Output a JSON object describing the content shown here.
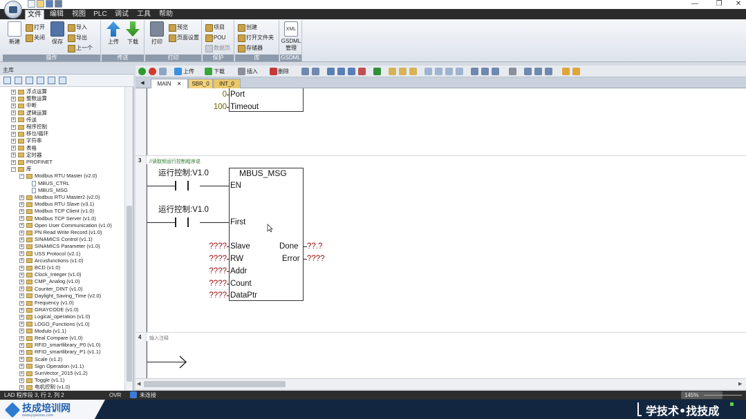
{
  "menu": {
    "tabs": [
      {
        "label": "文件",
        "active": true
      },
      {
        "label": "编辑"
      },
      {
        "label": "视图"
      },
      {
        "label": "PLC"
      },
      {
        "label": "调试"
      },
      {
        "label": "工具"
      },
      {
        "label": "帮助"
      }
    ]
  },
  "ribbon": {
    "groups": {
      "operation": "操作",
      "transfer": "传送",
      "print": "打印",
      "protect": "保护",
      "library": "库",
      "gsdml": "GSDML"
    },
    "new": "新建",
    "open": "打开",
    "close": "关闭",
    "save": "保存",
    "import": "导入",
    "export": "导出",
    "previous": "上一个",
    "upload": "上传",
    "download": "下载",
    "print_btn": "打印",
    "preview": "预览",
    "page_setup": "页面设置",
    "project": "项目",
    "pou": "POU",
    "data_page": "数据页",
    "create": "创建",
    "open_folder": "打开文件夹",
    "memory": "存储器",
    "gsdml_manage_1": "GSDML",
    "gsdml_manage_2": "管理",
    "xml_icon": "XML"
  },
  "left_panel": {
    "title": "主库",
    "tree": [
      {
        "label": "浮点运算",
        "level": 1,
        "kind": "folder",
        "expander": "+"
      },
      {
        "label": "整数运算",
        "level": 1,
        "kind": "folder",
        "expander": "+"
      },
      {
        "label": "中断",
        "level": 1,
        "kind": "folder",
        "expander": "+"
      },
      {
        "label": "逻辑运算",
        "level": 1,
        "kind": "folder",
        "expander": "+"
      },
      {
        "label": "传送",
        "level": 1,
        "kind": "folder",
        "expander": "+"
      },
      {
        "label": "程序控制",
        "level": 1,
        "kind": "folder",
        "expander": "+"
      },
      {
        "label": "移位/循环",
        "level": 1,
        "kind": "folder",
        "expander": "+"
      },
      {
        "label": "字符串",
        "level": 1,
        "kind": "folder",
        "expander": "+"
      },
      {
        "label": "表格",
        "level": 1,
        "kind": "folder",
        "expander": "+"
      },
      {
        "label": "定时器",
        "level": 1,
        "kind": "folder",
        "expander": "+"
      },
      {
        "label": "PROFINET",
        "level": 1,
        "kind": "folder",
        "expander": "+"
      },
      {
        "label": "库",
        "level": 1,
        "kind": "folder",
        "expander": "−"
      },
      {
        "label": "Modbus RTU Master (v2.0)",
        "level": 2,
        "kind": "folder",
        "expander": "−"
      },
      {
        "label": "MBUS_CTRL",
        "level": 3,
        "kind": "doc",
        "expander": ""
      },
      {
        "label": "MBUS_MSG",
        "level": 3,
        "kind": "doc",
        "expander": ""
      },
      {
        "label": "Modbus RTU Master2 (v2.0)",
        "level": 2,
        "kind": "folder",
        "expander": "+"
      },
      {
        "label": "Modbus RTU Slave (v3.1)",
        "level": 2,
        "kind": "folder",
        "expander": "+"
      },
      {
        "label": "Modbus TCP Client (v1.0)",
        "level": 2,
        "kind": "folder",
        "expander": "+"
      },
      {
        "label": "Modbus TCP Server (v1.0)",
        "level": 2,
        "kind": "folder",
        "expander": "+"
      },
      {
        "label": "Open User Communication (v1.0)",
        "level": 2,
        "kind": "folder",
        "expander": "+"
      },
      {
        "label": "PN Read Write Record (v1.0)",
        "level": 2,
        "kind": "folder",
        "expander": "+"
      },
      {
        "label": "SINAMICS Control (v1.1)",
        "level": 2,
        "kind": "folder",
        "expander": "+"
      },
      {
        "label": "SINAMICS Parameter (v1.0)",
        "level": 2,
        "kind": "folder",
        "expander": "+"
      },
      {
        "label": "USS Protocol (v2.1)",
        "level": 2,
        "kind": "folder",
        "expander": "+"
      },
      {
        "label": "Arcusfunctions (v1.0)",
        "level": 2,
        "kind": "folder",
        "expander": "+"
      },
      {
        "label": "BCD (v1.0)",
        "level": 2,
        "kind": "folder",
        "expander": "+"
      },
      {
        "label": "Clock_Integer (v1.0)",
        "level": 2,
        "kind": "folder",
        "expander": "+"
      },
      {
        "label": "CMP_Analog (v1.0)",
        "level": 2,
        "kind": "folder",
        "expander": "+"
      },
      {
        "label": "Counter_DINT (v1.0)",
        "level": 2,
        "kind": "folder",
        "expander": "+"
      },
      {
        "label": "Daylight_Saving_Time (v2.0)",
        "level": 2,
        "kind": "folder",
        "expander": "+"
      },
      {
        "label": "Frequency (v1.0)",
        "level": 2,
        "kind": "folder",
        "expander": "+"
      },
      {
        "label": "GRAYCODE (v1.0)",
        "level": 2,
        "kind": "folder",
        "expander": "+"
      },
      {
        "label": "Logical_operation (v1.0)",
        "level": 2,
        "kind": "folder",
        "expander": "+"
      },
      {
        "label": "LOGO_Functions (v1.0)",
        "level": 2,
        "kind": "folder",
        "expander": "+"
      },
      {
        "label": "Modulo (v1.1)",
        "level": 2,
        "kind": "folder",
        "expander": "+"
      },
      {
        "label": "Real Compare (v1.0)",
        "level": 2,
        "kind": "folder",
        "expander": "+"
      },
      {
        "label": "RFID_smartlibrary_P0 (v1.0)",
        "level": 2,
        "kind": "folder",
        "expander": "+"
      },
      {
        "label": "RFID_smartlibrary_P1 (v1.1)",
        "level": 2,
        "kind": "folder",
        "expander": "+"
      },
      {
        "label": "Scale (v1.2)",
        "level": 2,
        "kind": "folder",
        "expander": "+"
      },
      {
        "label": "Sign Operation (v1.1)",
        "level": 2,
        "kind": "folder",
        "expander": "+"
      },
      {
        "label": "SunVector_2015 (v1.2)",
        "level": 2,
        "kind": "folder",
        "expander": "+"
      },
      {
        "label": "Toggle (v1.1)",
        "level": 2,
        "kind": "folder",
        "expander": "+"
      },
      {
        "label": "电机控制 (v1.0)",
        "level": 2,
        "kind": "folder",
        "expander": "+"
      }
    ]
  },
  "editor_toolbar": {
    "upload": "上传",
    "download": "下载",
    "insert": "插入",
    "delete": "删除"
  },
  "editor_tabs": [
    {
      "label": "MAIN",
      "active": true
    },
    {
      "label": "SBR_0"
    },
    {
      "label": "INT_0"
    }
  ],
  "ladder": {
    "rung2": {
      "port_value": "0",
      "port_label": "Port",
      "timeout_value": "100",
      "timeout_label": "Timeout"
    },
    "rung3": {
      "number": "3",
      "comment": "//读取频运行控制程序说",
      "contact1": "运行控制:V1.0",
      "contact2": "运行控制:V1.0",
      "block_title": "MBUS_MSG",
      "en": "EN",
      "first": "First",
      "slave_value": "????",
      "slave": "Slave",
      "rw_value": "????",
      "rw": "RW",
      "addr_value": "????",
      "addr": "Addr",
      "count_value": "????",
      "count": "Count",
      "dataptr_value": "????",
      "dataptr": "DataPtr",
      "done": "Done",
      "done_value": "??.?",
      "error": "Error",
      "error_value": "????"
    },
    "rung4": {
      "number": "4",
      "comment": "输入注释"
    }
  },
  "status": {
    "position": "LAD 程序段 3, 行 2, 列 2",
    "mode": "OVR",
    "connection": "未连接",
    "zoom": "145%"
  },
  "brand": {
    "name": "技成培训网",
    "url": "www.jcpeixun.com",
    "slogan": "学技术•找技成"
  },
  "colors": {
    "accent": "#2e7bd1",
    "tab_sbr": "#f3d27a",
    "value_red": "#9a0f0f",
    "value_olive": "#6e6200",
    "brand_bg": "#12263f"
  }
}
